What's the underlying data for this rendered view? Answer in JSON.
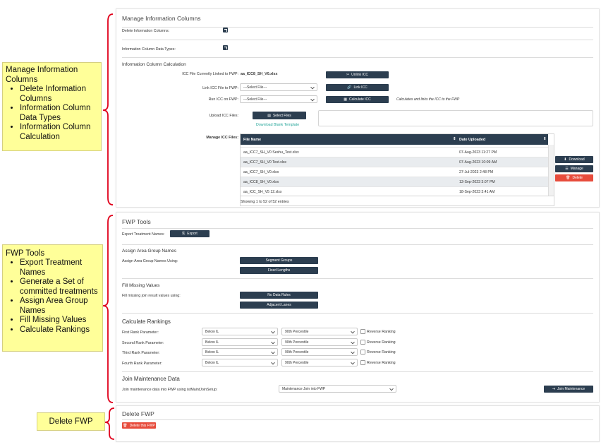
{
  "annotations": {
    "manage": {
      "title": "Manage Information Columns",
      "items": [
        "Delete Information Columns",
        "Information Column Data Types",
        "Information Column Calculation"
      ]
    },
    "fwp": {
      "title": "FWP Tools",
      "items": [
        "Export Treatment Names",
        "Generate a Set of committed treatments",
        "Assign Area Group Names",
        "Fill Missing Values",
        "Calculate Rankings"
      ]
    },
    "delete": {
      "title": "Delete FWP"
    }
  },
  "manage_panel": {
    "title": "Manage Information Columns",
    "delete_cols_label": "Delete Information Columns:",
    "data_types_label": "Information Column Data Types:",
    "calc_title": "Information Column Calculation",
    "icc_linked_label": "ICC File Currently Linked to FWP:",
    "icc_linked_value": "aa_ICC8_SH_V0.xlsx",
    "unlink_btn": "Unlink ICC",
    "link_label": "Link ICC File to FWP:",
    "link_select": "---Select File---",
    "link_btn": "Link ICC",
    "run_label": "Run ICC on FWP:",
    "run_select": "---Select File---",
    "calc_btn": "Calculate ICC",
    "calc_note": "Calculates and links the ICC to the FWP",
    "upload_label": "Upload ICC Files:",
    "select_files_btn": "Select Files",
    "download_template": "Download Blank Template",
    "manage_files_label": "Manage ICC Files:",
    "table": {
      "col_file": "File Name",
      "col_date": "Date Uploaded",
      "rows": [
        {
          "file": "aa_ICC7_SH_V0 Seshu_Test.xlsx",
          "date": "07-Aug-2023 11:27 PM"
        },
        {
          "file": "aa_ICC7_SH_V0 Test.xlsx",
          "date": "07-Aug-2023 10:09 AM"
        },
        {
          "file": "aa_ICC7_SH_V0.xlsx",
          "date": "27-Jul-2023 2:48 PM"
        },
        {
          "file": "aa_ICC8_SH_V0.xlsx",
          "date": "13-Sep-2023 3:07 PM"
        },
        {
          "file": "aa_ICC_SH_V5 12.xlsx",
          "date": "18-Sep-2023 3:41 AM"
        }
      ],
      "footer": "Showing 1 to 52 of 52 entries"
    },
    "download_btn": "Download",
    "manage_btn": "Manage",
    "delete_btn": "Delete"
  },
  "fwp_panel": {
    "title": "FWP Tools",
    "export_label": "Export Treatment Names:",
    "export_btn": "Export",
    "assign_title": "Assign Area Group Names",
    "assign_label": "Assign Area Group Names Using:",
    "segment_btn": "Segment Groups",
    "fixed_btn": "Fixed Lengths",
    "fill_title": "Fill Missing Values",
    "fill_label": "Fill missing join result values using:",
    "no_data_btn": "No Data Rules",
    "adjacent_btn": "Adjacent Lanes",
    "rank_title": "Calculate Rankings",
    "ranks": [
      {
        "label": "First Rank Parameter:",
        "sel1": "Below IL",
        "sel2": "90th Percentile",
        "reverse": "Reverse Ranking"
      },
      {
        "label": "Second Rank Parameter:",
        "sel1": "Below IL",
        "sel2": "90th Percentile",
        "reverse": "Reverse Ranking"
      },
      {
        "label": "Third Rank Parameter:",
        "sel1": "Below IL",
        "sel2": "90th Percentile",
        "reverse": "Reverse Ranking"
      },
      {
        "label": "Fourth Rank Parameter:",
        "sel1": "Below IL",
        "sel2": "90th Percentile",
        "reverse": "Reverse Ranking"
      }
    ],
    "join_title": "Join Maintenance Data",
    "join_label": "Join maintenance data into FWP using istMaintJoinSetup:",
    "join_select": "Maintenance Join into FWP",
    "join_btn": "Join Maintenance"
  },
  "delete_panel": {
    "title": "Delete FWP",
    "delete_btn": "Delete this FWP"
  },
  "colors": {
    "dark": "#2c3e50",
    "red": "#e74c3c",
    "note": "#ffff99",
    "bracket": "#e0001b",
    "link": "#26a69a"
  }
}
